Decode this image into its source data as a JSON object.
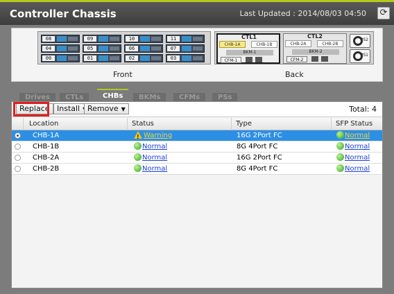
{
  "window": {
    "title": "Controller Chassis",
    "last_updated": "Last Updated : 2014/08/03 04:50",
    "refresh_icon": "refresh-icon"
  },
  "chassis": {
    "front_caption": "Front",
    "back_caption": "Back",
    "front_slots": [
      "08",
      "09",
      "10",
      "11",
      "04",
      "05",
      "06",
      "07",
      "00",
      "01",
      "02",
      "03"
    ],
    "ctl1": {
      "label": "CTL1",
      "chb_a": "CHB-1A",
      "chb_b": "CHB-1B",
      "bkm": "BKM-1",
      "cfm": "CFM-1"
    },
    "ctl2": {
      "label": "CTL2",
      "chb_a": "CHB-2A",
      "chb_b": "CHB-2B",
      "bkm": "BKM-2",
      "cfm": "CFM-2"
    },
    "ps1": "PS1",
    "ps2": "PS2"
  },
  "tabs": [
    {
      "label": "Drives"
    },
    {
      "label": "CTLs"
    },
    {
      "label": "CHBs"
    },
    {
      "label": "BKMs"
    },
    {
      "label": "CFMs"
    },
    {
      "label": "PSs"
    }
  ],
  "toolbar": {
    "replace_label": "Replace",
    "install_label": "Install",
    "remove_label": "Remove",
    "total": "Total: 4"
  },
  "table": {
    "columns": [
      "Location",
      "Status",
      "Type",
      "SFP Status"
    ],
    "rows": [
      {
        "location": "CHB-1A",
        "status": "Warning",
        "type": "16G 2Port FC",
        "sfp": "Normal"
      },
      {
        "location": "CHB-1B",
        "status": "Normal",
        "type": "8G 4Port FC",
        "sfp": "Normal"
      },
      {
        "location": "CHB-2A",
        "status": "Normal",
        "type": "16G 2Port FC",
        "sfp": "Normal"
      },
      {
        "location": "CHB-2B",
        "status": "Normal",
        "type": "8G 4Port FC",
        "sfp": "Normal"
      }
    ]
  },
  "colors": {
    "accent": "#b4c81e",
    "selection": "#2c8fe4",
    "highlight_box": "#e02020"
  }
}
